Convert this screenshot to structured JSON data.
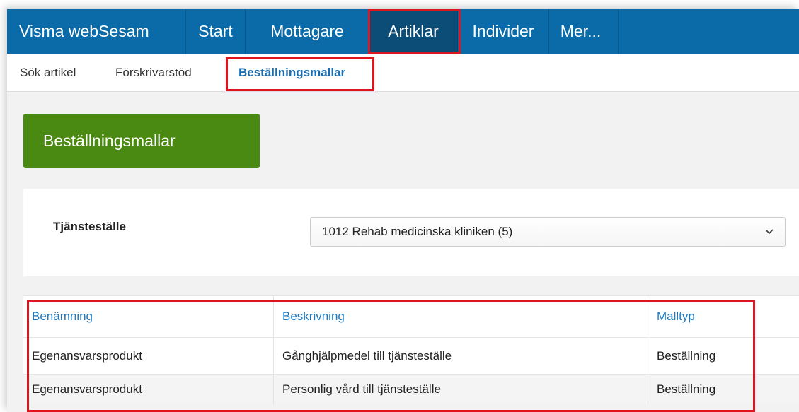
{
  "nav": {
    "brand": "Visma webSesam",
    "items": [
      "Start",
      "Mottagare",
      "Artiklar",
      "Individer",
      "Mer..."
    ],
    "active": "Artiklar"
  },
  "subnav": {
    "items": [
      "Sök artikel",
      "Förskrivarstöd",
      "Beställningsmallar"
    ],
    "active": "Beställningsmallar"
  },
  "page": {
    "title": "Beställningsmallar"
  },
  "filter": {
    "label": "Tjänsteställe",
    "selected": "1012 Rehab medicinska kliniken (5)"
  },
  "table": {
    "columns": [
      "Benämning",
      "Beskrivning",
      "Malltyp"
    ],
    "rows": [
      [
        "Egenansvarsprodukt",
        "Gånghjälpmedel till tjänsteställe",
        "Beställning"
      ],
      [
        "Egenansvarsprodukt",
        "Personlig vård till tjänsteställe",
        "Beställning"
      ]
    ]
  },
  "colors": {
    "nav_bg": "#0a6ba8",
    "nav_active_bg": "#0c4d78",
    "accent_green": "#4a8a12",
    "link_blue": "#1b7ac2",
    "highlight_red": "#e0141e"
  }
}
